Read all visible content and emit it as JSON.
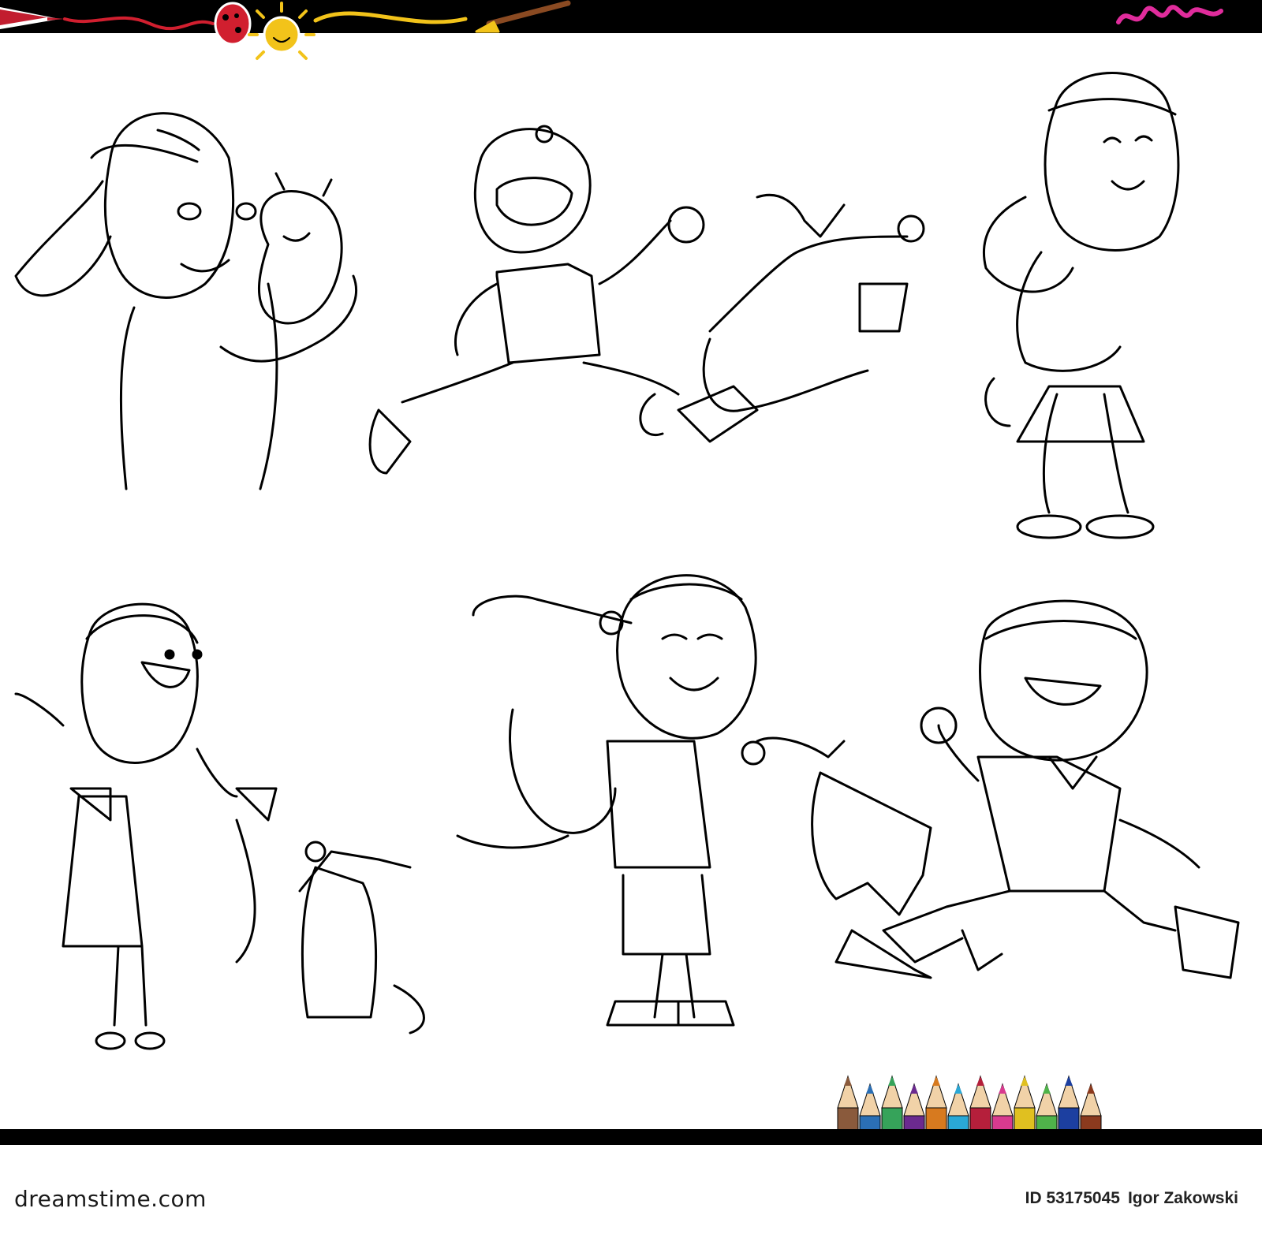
{
  "footer": {
    "brand": "dreamstime.com",
    "id_label": "ID 53175045",
    "author": "Igor Zakowski"
  },
  "colors": {
    "line": "#000000",
    "background": "#ffffff",
    "pencils": [
      "#8a5a3c",
      "#2b6fb5",
      "#36a35a",
      "#6b2a8f",
      "#d77a1f",
      "#2aa8d6",
      "#b51f3b",
      "#d93a8f",
      "#e0c020",
      "#4fb34a",
      "#1c3fa0",
      "#8b3a1e"
    ]
  },
  "icons": [
    "pencil-icon",
    "ladybug-icon",
    "sun-icon",
    "paintbrush-icon",
    "scribble-icon",
    "colored-pencils-icon"
  ]
}
